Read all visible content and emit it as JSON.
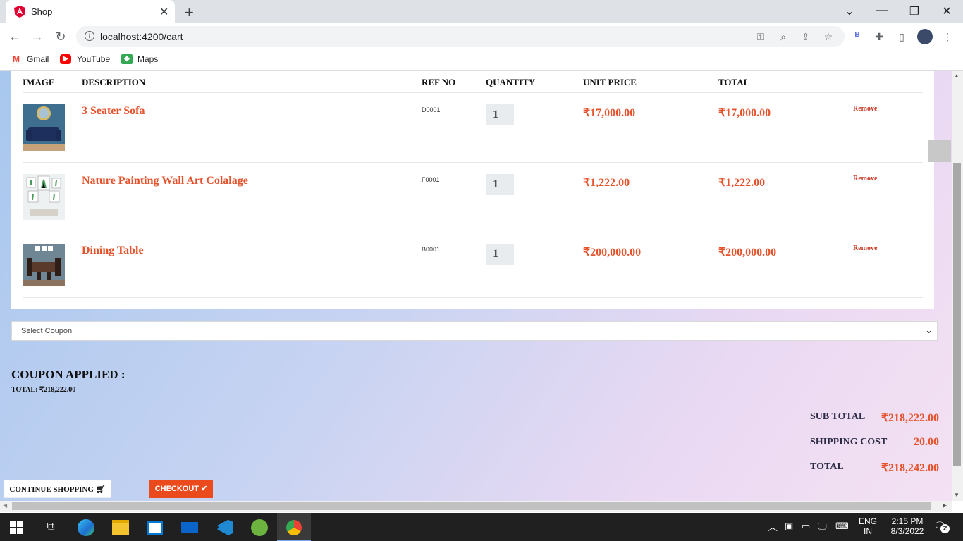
{
  "browser": {
    "tab_title": "Shop",
    "url": "localhost:4200/cart",
    "bookmarks": [
      {
        "label": "Gmail",
        "icon": "gmail-icon"
      },
      {
        "label": "YouTube",
        "icon": "youtube-icon"
      },
      {
        "label": "Maps",
        "icon": "maps-icon"
      }
    ],
    "profile_letter": "B"
  },
  "cart": {
    "headers": {
      "image": "IMAGE",
      "description": "DESCRIPTION",
      "ref_no": "REF NO",
      "quantity": "QUANTITY",
      "unit_price": "UNIT PRICE",
      "total": "TOTAL"
    },
    "items": [
      {
        "description": "3 Seater Sofa",
        "ref": "D0001",
        "qty": "1",
        "unit_price": "₹17,000.00",
        "total": "₹17,000.00",
        "remove": "Remove",
        "thumb_color": "#1f3a6b"
      },
      {
        "description": "Nature Painting Wall Art Colalage",
        "ref": "F0001",
        "qty": "1",
        "unit_price": "₹1,222.00",
        "total": "₹1,222.00",
        "remove": "Remove",
        "thumb_color": "#e8ecef"
      },
      {
        "description": "Dining Table",
        "ref": "B0001",
        "qty": "1",
        "unit_price": "₹200,000.00",
        "total": "₹200,000.00",
        "remove": "Remove",
        "thumb_color": "#4a5a66"
      }
    ]
  },
  "coupon": {
    "select_placeholder": "Select Coupon",
    "applied_label": "COUPON APPLIED :",
    "total_line": "TOTAL: ₹218,222.00"
  },
  "summary": {
    "sub_total_label": "SUB TOTAL",
    "sub_total_value": "₹218,222.00",
    "shipping_label": "SHIPPING COST",
    "shipping_value": "20.00",
    "total_label": "TOTAL",
    "total_value": "₹218,242.00"
  },
  "actions": {
    "continue_label": "CONTINUE SHOPPING",
    "checkout_label": "CHECKOUT"
  },
  "taskbar": {
    "lang_top": "ENG",
    "lang_bottom": "IN",
    "time": "2:15 PM",
    "date": "8/3/2022",
    "notifications": "2"
  },
  "colors": {
    "accent": "#e5522b",
    "checkout_bg": "#ea4a1c"
  }
}
